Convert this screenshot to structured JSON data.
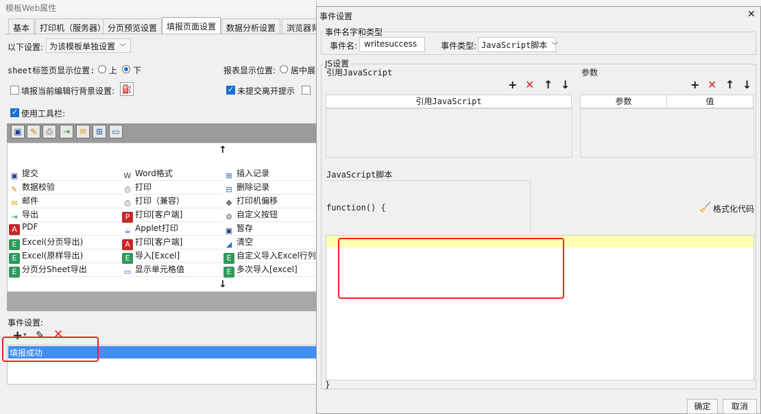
{
  "bg_window": {
    "title": "模板Web属性",
    "tabs": [
      "基本",
      "打印机（服务器）",
      "分页预览设置",
      "填报页面设置",
      "数据分析设置",
      "浏览器背"
    ],
    "active_tab": "填报页面设置",
    "settings_label": "以下设置:",
    "settings_value": "为该模板单独设置",
    "sheet_pos_label": "sheet标签页显示位置:",
    "radio_top": "上",
    "radio_bottom": "下",
    "report_pos_label": "报表显示位置:",
    "radio_center": "居中展",
    "bg_checkbox_label": "填报当前编辑行背景设置:",
    "unsubmitted_label": "未提交离开提示",
    "use_toolbar_label": "使用工具栏:",
    "buttons": [
      [
        "提交",
        "Word格式",
        "插入记录"
      ],
      [
        "数据校验",
        "打印",
        "删除记录"
      ],
      [
        "邮件",
        "打印（兼容）",
        "打印机偏移"
      ],
      [
        "导出",
        "打印[客户端]",
        "自定义按钮"
      ],
      [
        "PDF",
        "Applet打印",
        "暂存"
      ],
      [
        "Excel(分页导出)",
        "打印[客户端]",
        "清空"
      ],
      [
        "Excel(原样导出)",
        "导入[Excel]",
        "自定义导入Excel行列"
      ],
      [
        "分页分Sheet导出",
        "显示单元格值",
        "多次导入[excel]"
      ]
    ],
    "event_settings_label": "事件设置:",
    "event_item": "填报成功"
  },
  "dialog": {
    "title": "事件设置",
    "section_name": "事件名字和类型",
    "event_name_label": "事件名:",
    "event_name_value": "writesuccess",
    "event_type_label": "事件类型:",
    "event_type_value": "JavaScript脚本",
    "js_section": "JS设置",
    "ref_js_label": "引用JavaScript",
    "params_label": "参数",
    "ref_js_col": "引用JavaScript",
    "param_col": "参数",
    "value_col": "值",
    "script_label": "JavaScript脚本",
    "function_text": "function() {",
    "format_label": "格式化代码",
    "closing_brace": "}",
    "ok": "确定",
    "cancel": "取消"
  }
}
